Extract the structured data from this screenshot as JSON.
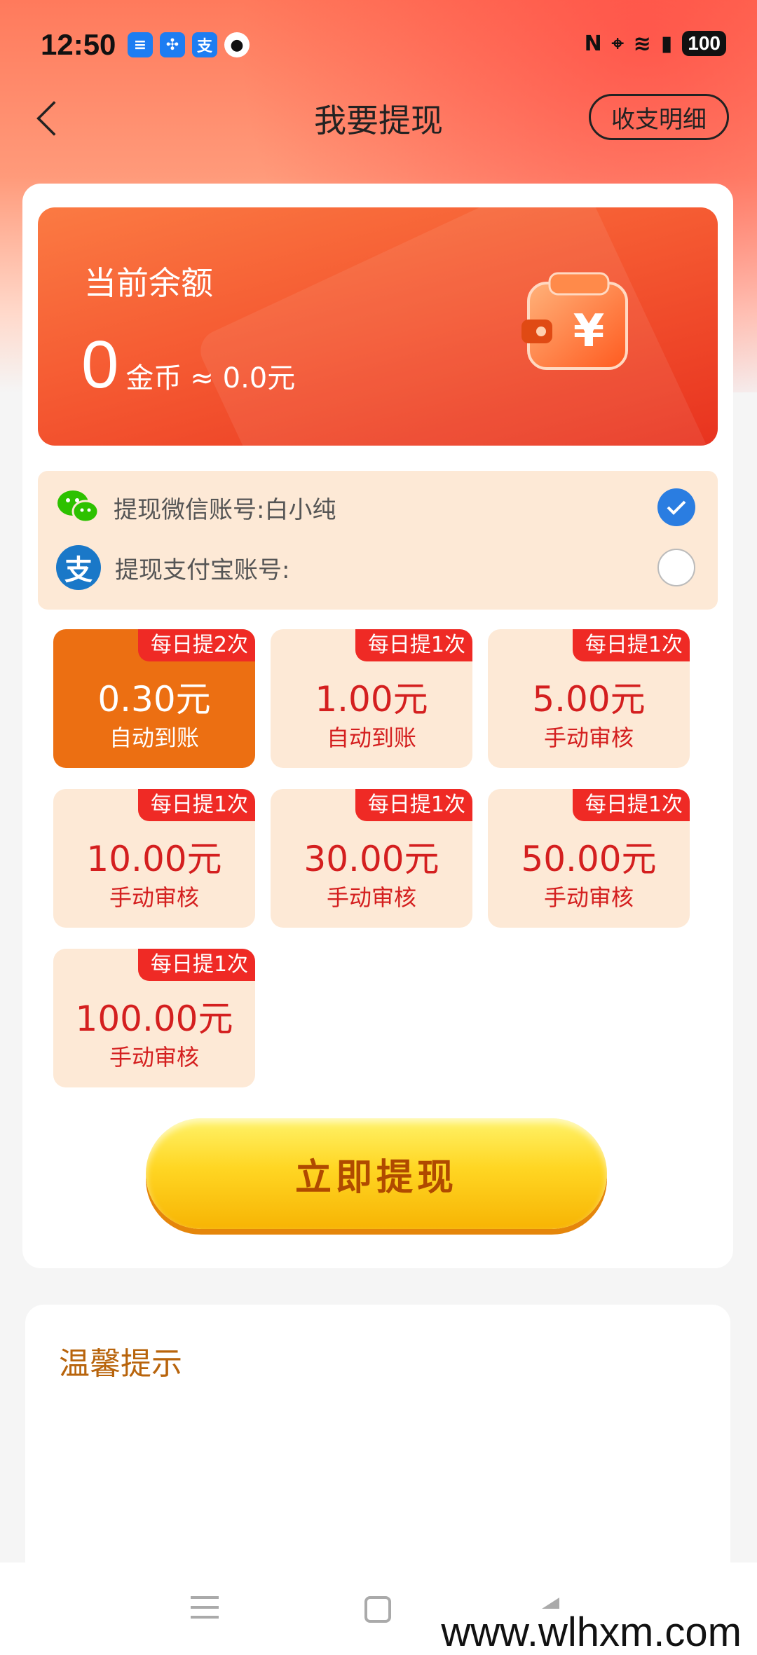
{
  "status_bar": {
    "time": "12:50",
    "notif_icons": [
      "message-icon",
      "pinwheel-icon",
      "alipay-icon",
      "qq-icon"
    ],
    "battery": "100"
  },
  "nav": {
    "title": "我要提现",
    "detail_button": "收支明细"
  },
  "balance": {
    "label": "当前余额",
    "value": "0",
    "unit": "金币",
    "approx": "≈ 0.0元"
  },
  "accounts": {
    "wechat_label": "提现微信账号:白小纯",
    "wechat_selected": true,
    "alipay_label": "提现支付宝账号:",
    "alipay_selected": false,
    "alipay_icon_char": "支"
  },
  "amounts": [
    {
      "tag": "每日提2次",
      "value": "0.30元",
      "sub": "自动到账",
      "selected": true
    },
    {
      "tag": "每日提1次",
      "value": "1.00元",
      "sub": "自动到账",
      "selected": false
    },
    {
      "tag": "每日提1次",
      "value": "5.00元",
      "sub": "手动审核",
      "selected": false
    },
    {
      "tag": "每日提1次",
      "value": "10.00元",
      "sub": "手动审核",
      "selected": false
    },
    {
      "tag": "每日提1次",
      "value": "30.00元",
      "sub": "手动审核",
      "selected": false
    },
    {
      "tag": "每日提1次",
      "value": "50.00元",
      "sub": "手动审核",
      "selected": false
    },
    {
      "tag": "每日提1次",
      "value": "100.00元",
      "sub": "手动审核",
      "selected": false
    }
  ],
  "withdraw_button": "立即提现",
  "tips": {
    "title": "温馨提示"
  },
  "watermark": "www.wlhxm.com",
  "colors": {
    "accent_orange": "#ec6f12",
    "tag_red": "#ef2a25",
    "amount_red": "#d41f1f",
    "radio_blue": "#2a7de1",
    "button_yellow": "#ffd623"
  }
}
